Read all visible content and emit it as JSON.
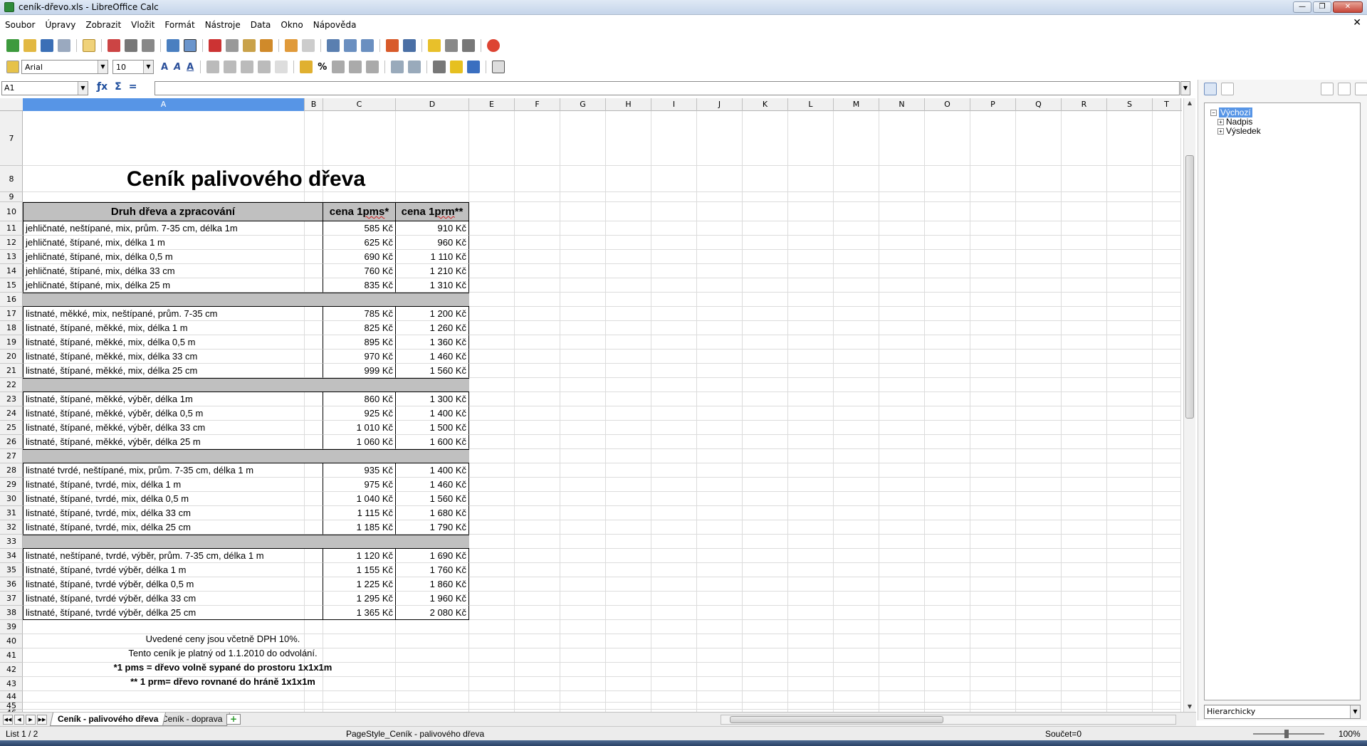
{
  "window": {
    "title": "ceník-dřevo.xls - LibreOffice Calc",
    "controls": [
      "—",
      "❐",
      "✕"
    ],
    "doc_close": "✕"
  },
  "menu": [
    "Soubor",
    "Úpravy",
    "Zobrazit",
    "Vložit",
    "Formát",
    "Nástroje",
    "Data",
    "Okno",
    "Nápověda"
  ],
  "format_toolbar": {
    "font_name": "Arial",
    "font_size": "10"
  },
  "formula_bar": {
    "cell_ref": "A1",
    "content": ""
  },
  "columns": [
    "A",
    "B",
    "C",
    "D",
    "E",
    "F",
    "G",
    "H",
    "I",
    "J",
    "K",
    "L",
    "M",
    "N",
    "O",
    "P",
    "Q",
    "R",
    "S",
    "T"
  ],
  "selected_column": "A",
  "sheet": {
    "title": "Ceník palivového dřeva",
    "headers": {
      "product": "Druh dřeva a zpracování",
      "price_pms": "cena 1 pms*",
      "price_prm": "cena 1 prm**"
    },
    "rows": [
      {
        "row": 11,
        "name": "jehličnaté, neštípané, mix, prům. 7-35 cm, délka 1m",
        "pms": "585 Kč",
        "prm": "910 Kč"
      },
      {
        "row": 12,
        "name": "jehličnaté, štípané, mix, délka 1 m",
        "pms": "625 Kč",
        "prm": "960 Kč"
      },
      {
        "row": 13,
        "name": "jehličnaté, štípané, mix, délka 0,5 m",
        "pms": "690 Kč",
        "prm": "1 110 Kč"
      },
      {
        "row": 14,
        "name": "jehličnaté, štípané, mix, délka 33 cm",
        "pms": "760 Kč",
        "prm": "1 210 Kč"
      },
      {
        "row": 15,
        "name": "jehličnaté, štípané, mix, délka 25 m",
        "pms": "835 Kč",
        "prm": "1 310 Kč"
      },
      {
        "row": 17,
        "name": "listnaté, měkké, mix, neštípané, prům. 7-35 cm",
        "pms": "785 Kč",
        "prm": "1 200 Kč"
      },
      {
        "row": 18,
        "name": "listnaté, štípané, měkké, mix, délka 1 m",
        "pms": "825 Kč",
        "prm": "1 260 Kč"
      },
      {
        "row": 19,
        "name": "listnaté, štípané, měkké, mix, délka 0,5 m",
        "pms": "895 Kč",
        "prm": "1 360 Kč"
      },
      {
        "row": 20,
        "name": "listnaté, štípané, měkké, mix, délka 33 cm",
        "pms": "970 Kč",
        "prm": "1 460 Kč"
      },
      {
        "row": 21,
        "name": "listnaté, štípané, měkké, mix, délka 25 cm",
        "pms": "999 Kč",
        "prm": "1 560 Kč"
      },
      {
        "row": 23,
        "name": "listnaté, štípané, měkké, výběr, délka 1m",
        "pms": "860 Kč",
        "prm": "1 300 Kč"
      },
      {
        "row": 24,
        "name": "listnaté, štípané, měkké, výběr, délka 0,5 m",
        "pms": "925 Kč",
        "prm": "1 400 Kč"
      },
      {
        "row": 25,
        "name": "listnaté, štípané, měkké, výběr, délka 33 cm",
        "pms": "1 010 Kč",
        "prm": "1 500 Kč"
      },
      {
        "row": 26,
        "name": "listnaté, štípané, měkké, výběr, délka 25 m",
        "pms": "1 060 Kč",
        "prm": "1 600 Kč"
      },
      {
        "row": 28,
        "name": "listnaté tvrdé, neštípané, mix, prům. 7-35 cm, délka 1 m",
        "pms": "935 Kč",
        "prm": "1 400 Kč"
      },
      {
        "row": 29,
        "name": "listnaté, štípané, tvrdé, mix, délka 1 m",
        "pms": "975 Kč",
        "prm": "1 460 Kč"
      },
      {
        "row": 30,
        "name": "listnaté, štípané, tvrdé, mix, délka 0,5 m",
        "pms": "1 040 Kč",
        "prm": "1 560 Kč"
      },
      {
        "row": 31,
        "name": "listnaté, štípané, tvrdé, mix, délka 33 cm",
        "pms": "1 115 Kč",
        "prm": "1 680 Kč"
      },
      {
        "row": 32,
        "name": "listnaté, štípané, tvrdé, mix, délka 25 cm",
        "pms": "1 185 Kč",
        "prm": "1 790 Kč"
      },
      {
        "row": 34,
        "name": "listnaté, neštípané, tvrdé, výběr, prům. 7-35 cm, délka 1 m",
        "pms": "1 120 Kč",
        "prm": "1 690 Kč"
      },
      {
        "row": 35,
        "name": "listnaté, štípané, tvrdé výběr, délka 1 m",
        "pms": "1 155 Kč",
        "prm": "1 760 Kč"
      },
      {
        "row": 36,
        "name": "listnaté, štípané, tvrdé výběr, délka 0,5 m",
        "pms": "1 225 Kč",
        "prm": "1 860 Kč"
      },
      {
        "row": 37,
        "name": "listnaté, štípané, tvrdé výběr, délka 33 cm",
        "pms": "1 295 Kč",
        "prm": "1 960 Kč"
      },
      {
        "row": 38,
        "name": "listnaté, štípané, tvrdé výběr, délka 25 cm",
        "pms": "1 365 Kč",
        "prm": "2 080 Kč"
      }
    ],
    "notes": [
      "Uvedené ceny jsou včetně DPH 10%.",
      "Tento ceník je platný od 1.1.2010 do odvolání.",
      "*1 pms = dřevo volně sypané do prostoru 1x1x1m",
      "** 1 prm= dřevo rovnané do hráně 1x1x1m"
    ]
  },
  "row_numbers": [
    "7",
    "8",
    "9",
    "10",
    "11",
    "12",
    "13",
    "14",
    "15",
    "16",
    "17",
    "18",
    "19",
    "20",
    "21",
    "22",
    "23",
    "24",
    "25",
    "26",
    "27",
    "28",
    "29",
    "30",
    "31",
    "32",
    "33",
    "34",
    "35",
    "36",
    "37",
    "38",
    "39",
    "40",
    "41",
    "42",
    "43",
    "44",
    "45",
    "46"
  ],
  "navigator": {
    "tree": [
      {
        "label": "Výchozí",
        "selected": true
      },
      {
        "label": "Nadpis",
        "selected": false
      },
      {
        "label": "Výsledek",
        "selected": false
      }
    ],
    "mode": "Hierarchicky"
  },
  "tabs": [
    "Ceník - palivového dřeva",
    "Ceník - doprava"
  ],
  "status": {
    "sheet": "List 1 / 2",
    "page_style": "PageStyle_Ceník - palivového dřeva",
    "sum": "Součet=0",
    "zoom": "100%",
    "zoom_level": 1.0
  },
  "colors": {
    "header_fill": "#c0c0c0",
    "selection": "#5795e6"
  }
}
